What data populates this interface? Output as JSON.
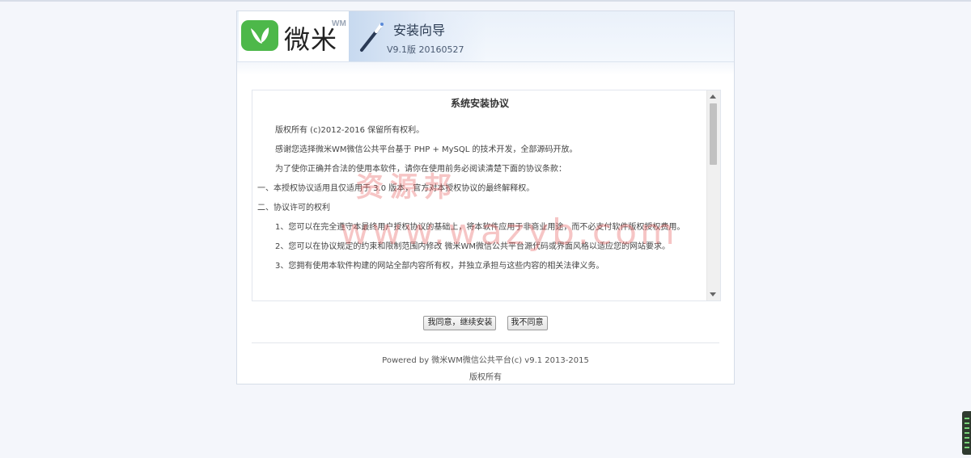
{
  "header": {
    "logo_text": "微米",
    "logo_superscript": "WM",
    "wizard_title": "安装向导",
    "version": "V9.1版 20160527"
  },
  "agreement": {
    "title": "系统安装协议",
    "paragraphs": [
      "版权所有 (c)2012-2016 保留所有权利。",
      "感谢您选择微米WM微信公共平台基于 PHP + MySQL 的技术开发，全部源码开放。",
      "为了使你正确并合法的使用本软件，请你在使用前务必阅读清楚下面的协议条款：",
      "一、本授权协议适用且仅适用于 3.0 版本，官方对本授权协议的最终解释权。",
      "二、协议许可的权利",
      "1、您可以在完全遵守本最终用户授权协议的基础上，将本软件应用于非商业用途，而不必支付软件版权授权费用。",
      "2、您可以在协议规定的约束和限制范围内修改 微米WM微信公共平台源代码或界面风格以适应您的网站要求。",
      "3、您拥有使用本软件构建的网站全部内容所有权，并独立承担与这些内容的相关法律义务。"
    ]
  },
  "buttons": {
    "agree": "我同意，继续安装",
    "disagree": "我不同意"
  },
  "footer": {
    "powered": "Powered by 微米WM微信公共平台(c) v9.1 2013-2015",
    "copyright": "版权所有"
  },
  "watermark": {
    "line1": "资源邦",
    "line2": "www.wazyb.com"
  },
  "colors": {
    "logo_green": "#4db84a",
    "watermark_red": "#e65a5a"
  },
  "icons": [
    "leaf-logo-icon",
    "magic-wand-icon"
  ]
}
